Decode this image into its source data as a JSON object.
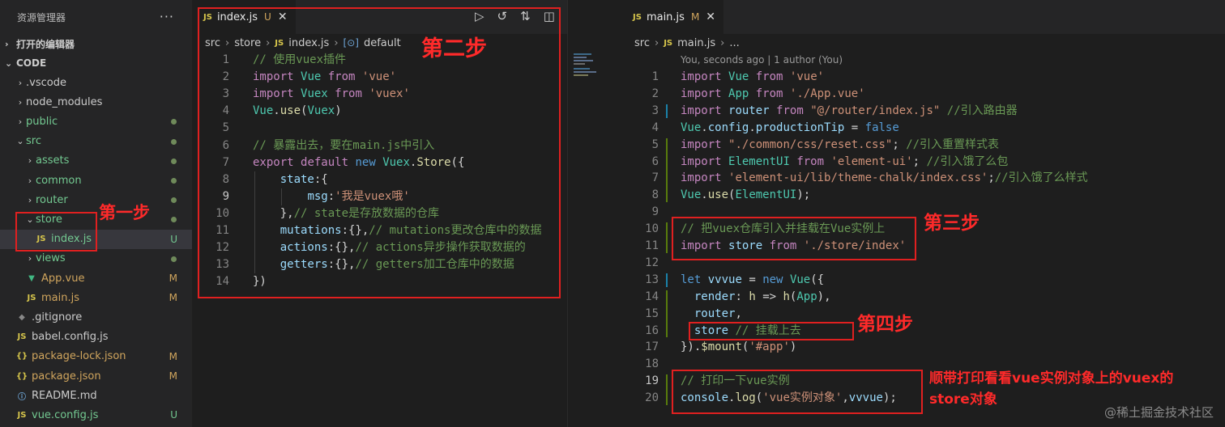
{
  "sidebar": {
    "title": "资源管理器",
    "more": "···",
    "open_editors": "打开的编辑器",
    "workspace": "CODE",
    "items": [
      {
        "label": ".vscode",
        "type": "folder",
        "status": ""
      },
      {
        "label": "node_modules",
        "type": "folder",
        "status": ""
      },
      {
        "label": "public",
        "type": "folder",
        "status": "dot"
      },
      {
        "label": "src",
        "type": "folder-open",
        "status": "dot"
      },
      {
        "label": "assets",
        "type": "folder",
        "status": "dot"
      },
      {
        "label": "common",
        "type": "folder",
        "status": "dot"
      },
      {
        "label": "router",
        "type": "folder",
        "status": "dot"
      },
      {
        "label": "store",
        "type": "folder-open",
        "status": "dot"
      },
      {
        "label": "index.js",
        "type": "js",
        "status": "U"
      },
      {
        "label": "views",
        "type": "folder",
        "status": "dot"
      },
      {
        "label": "App.vue",
        "type": "vue",
        "status": "M"
      },
      {
        "label": "main.js",
        "type": "js",
        "status": "M"
      },
      {
        "label": ".gitignore",
        "type": "git",
        "status": ""
      },
      {
        "label": "babel.config.js",
        "type": "js",
        "status": ""
      },
      {
        "label": "package-lock.json",
        "type": "json",
        "status": "M"
      },
      {
        "label": "package.json",
        "type": "json",
        "status": "M"
      },
      {
        "label": "README.md",
        "type": "info",
        "status": ""
      },
      {
        "label": "vue.config.js",
        "type": "js",
        "status": "U"
      }
    ]
  },
  "editor1": {
    "tab": {
      "icon": "JS",
      "name": "index.js",
      "status": "U",
      "close": "✕"
    },
    "breadcrumb": [
      "src",
      "store",
      "index.js",
      "default"
    ],
    "lines": [
      "// 使用vuex插件",
      "import Vue from 'vue'",
      "import Vuex from 'vuex'",
      "Vue.use(Vuex)",
      "",
      "// 暴露出去，要在main.js中引入",
      "export default new Vuex.Store({",
      "    state:{",
      "        msg:'我是vuex哦'",
      "    },// state是存放数据的仓库",
      "    mutations:{},// mutations更改仓库中的数据",
      "    actions:{},// actions异步操作获取数据的",
      "    getters:{},// getters加工仓库中的数据",
      "})"
    ]
  },
  "editor2": {
    "tab": {
      "icon": "JS",
      "name": "main.js",
      "status": "M",
      "close": "✕"
    },
    "breadcrumb": [
      "src",
      "main.js",
      "..."
    ],
    "blame": "You, seconds ago | 1 author (You)",
    "lines": [
      "import Vue from 'vue'",
      "import App from './App.vue'",
      "import router from \"@/router/index.js\" //引入路由器",
      "Vue.config.productionTip = false",
      "import \"./common/css/reset.css\"; //引入重置样式表",
      "import ElementUI from 'element-ui'; //引入饿了么包",
      "import 'element-ui/lib/theme-chalk/index.css';//引入饿了么样式",
      "Vue.use(ElementUI);",
      "",
      "// 把vuex仓库引入并挂载在Vue实例上",
      "import store from './store/index'",
      "",
      "let vvvue = new Vue({",
      "  render: h => h(App),",
      "  router,",
      "  store // 挂载上去",
      "}).$mount('#app')",
      "",
      "// 打印一下vue实例",
      "console.log('vue实例对象',vvvue);"
    ]
  },
  "annotations": {
    "step1": "第一步",
    "step2": "第二步",
    "step3": "第三步",
    "step4": "第四步",
    "note_line1": "顺带打印看看vue实例对象上的vuex的",
    "note_line2": "store对象"
  },
  "watermark": "@稀土掘金技术社区",
  "colors": {
    "annotation": "#e02020",
    "keyword": "#569cd6",
    "string": "#ce9178",
    "comment": "#6a9955"
  }
}
